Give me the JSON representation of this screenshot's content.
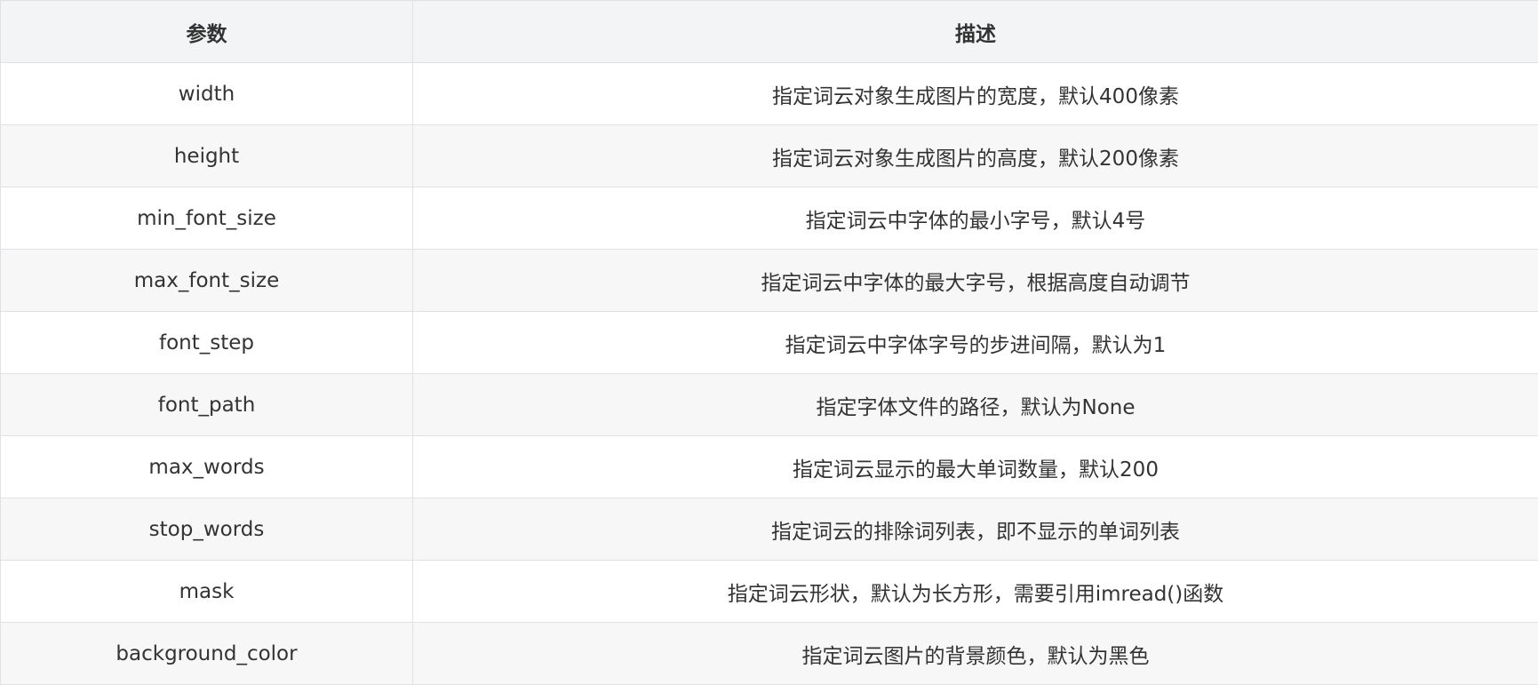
{
  "table": {
    "headers": [
      "参数",
      "描述"
    ],
    "rows": [
      {
        "param": "width",
        "desc": "指定词云对象生成图片的宽度，默认400像素"
      },
      {
        "param": "height",
        "desc": "指定词云对象生成图片的高度，默认200像素"
      },
      {
        "param": "min_font_size",
        "desc": "指定词云中字体的最小字号，默认4号"
      },
      {
        "param": "max_font_size",
        "desc": "指定词云中字体的最大字号，根据高度自动调节"
      },
      {
        "param": "font_step",
        "desc": "指定词云中字体字号的步进间隔，默认为1"
      },
      {
        "param": "font_path",
        "desc": "指定字体文件的路径，默认为None"
      },
      {
        "param": "max_words",
        "desc": "指定词云显示的最大单词数量，默认200"
      },
      {
        "param": "stop_words",
        "desc": "指定词云的排除词列表，即不显示的单词列表"
      },
      {
        "param": "mask",
        "desc": "指定词云形状，默认为长方形，需要引用imread()函数"
      },
      {
        "param": "background_color",
        "desc": "指定词云图片的背景颜色，默认为黑色"
      }
    ]
  },
  "colors": {
    "header_bg": "#f2f4f6",
    "row_alt_bg": "#f7f7f7",
    "border": "#dfe2e5",
    "text": "#333333"
  }
}
